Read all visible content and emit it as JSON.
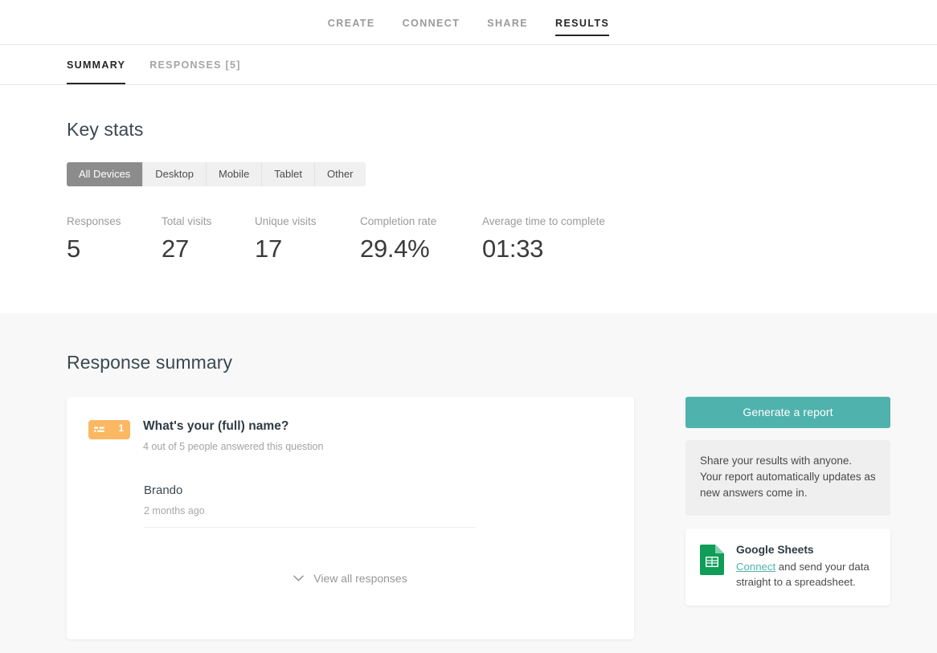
{
  "topnav": {
    "items": [
      {
        "label": "CREATE",
        "active": false
      },
      {
        "label": "CONNECT",
        "active": false
      },
      {
        "label": "SHARE",
        "active": false
      },
      {
        "label": "RESULTS",
        "active": true
      }
    ]
  },
  "subtabs": {
    "items": [
      {
        "label": "SUMMARY",
        "active": true
      },
      {
        "label": "RESPONSES [5]",
        "active": false
      }
    ]
  },
  "key_stats": {
    "title": "Key stats",
    "device_filter": {
      "options": [
        {
          "label": "All Devices",
          "active": true
        },
        {
          "label": "Desktop",
          "active": false
        },
        {
          "label": "Mobile",
          "active": false
        },
        {
          "label": "Tablet",
          "active": false
        },
        {
          "label": "Other",
          "active": false
        }
      ]
    },
    "stats": [
      {
        "label": "Responses",
        "value": "5"
      },
      {
        "label": "Total visits",
        "value": "27"
      },
      {
        "label": "Unique visits",
        "value": "17"
      },
      {
        "label": "Completion rate",
        "value": "29.4%"
      },
      {
        "label": "Average time to complete",
        "value": "01:33"
      }
    ]
  },
  "response_summary": {
    "title": "Response summary",
    "question_card": {
      "badge_number": "1",
      "badge_icon": "short-text-icon",
      "badge_color": "#fbb862",
      "question": "What's your (full) name?",
      "answered_note": "4 out of 5 people answered this question",
      "answers": [
        {
          "text": "Brando",
          "time": "2 months ago"
        },
        {
          "text": "",
          "time": ""
        }
      ],
      "view_all_label": "View all responses"
    },
    "rail": {
      "generate_report_label": "Generate a report",
      "generate_report_color": "#4fb2ad",
      "note": "Share your results with anyone. Your report automatically updates as new answers come in.",
      "integration": {
        "icon": "google-sheets-icon",
        "title": "Google Sheets",
        "link_label": "Connect",
        "text_after_link": " and send your data straight to a spreadsheet."
      }
    }
  }
}
